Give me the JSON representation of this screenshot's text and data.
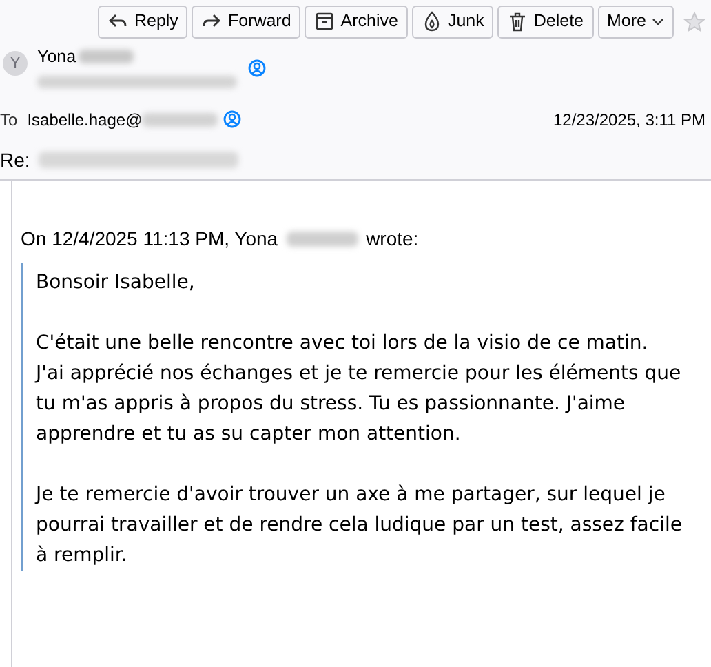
{
  "toolbar": {
    "buttons": [
      {
        "kind": "reply",
        "label": "Reply"
      },
      {
        "kind": "forward",
        "label": "Forward"
      },
      {
        "kind": "archive",
        "label": "Archive"
      },
      {
        "kind": "junk",
        "label": "Junk"
      },
      {
        "kind": "delete",
        "label": "Delete"
      },
      {
        "kind": "more",
        "label": "More"
      }
    ],
    "starred": false
  },
  "sender": {
    "avatar": "Y",
    "name": "Yona"
  },
  "to": {
    "label": "To",
    "address": "Isabelle.hage@"
  },
  "date": "12/23/2025, 3:11 PM",
  "subject": "Re:",
  "body": {
    "attribution_start": "On 12/4/2025 11:13 PM, Yona",
    "attribution_end": "wrote:",
    "quote": [
      "Bonsoir Isabelle,",
      "C'était une belle rencontre avec toi lors de la visio de ce matin.\nJ'ai apprécié nos échanges et je te remercie pour les éléments que tu m'as appris à propos du stress. Tu es passionnante. J'aime apprendre et tu as su capter mon attention.",
      "Je te remercie d'avoir trouver un axe à me partager, sur lequel je pourrai travailler et de rendre cela ludique par un test, assez facile à remplir."
    ]
  }
}
